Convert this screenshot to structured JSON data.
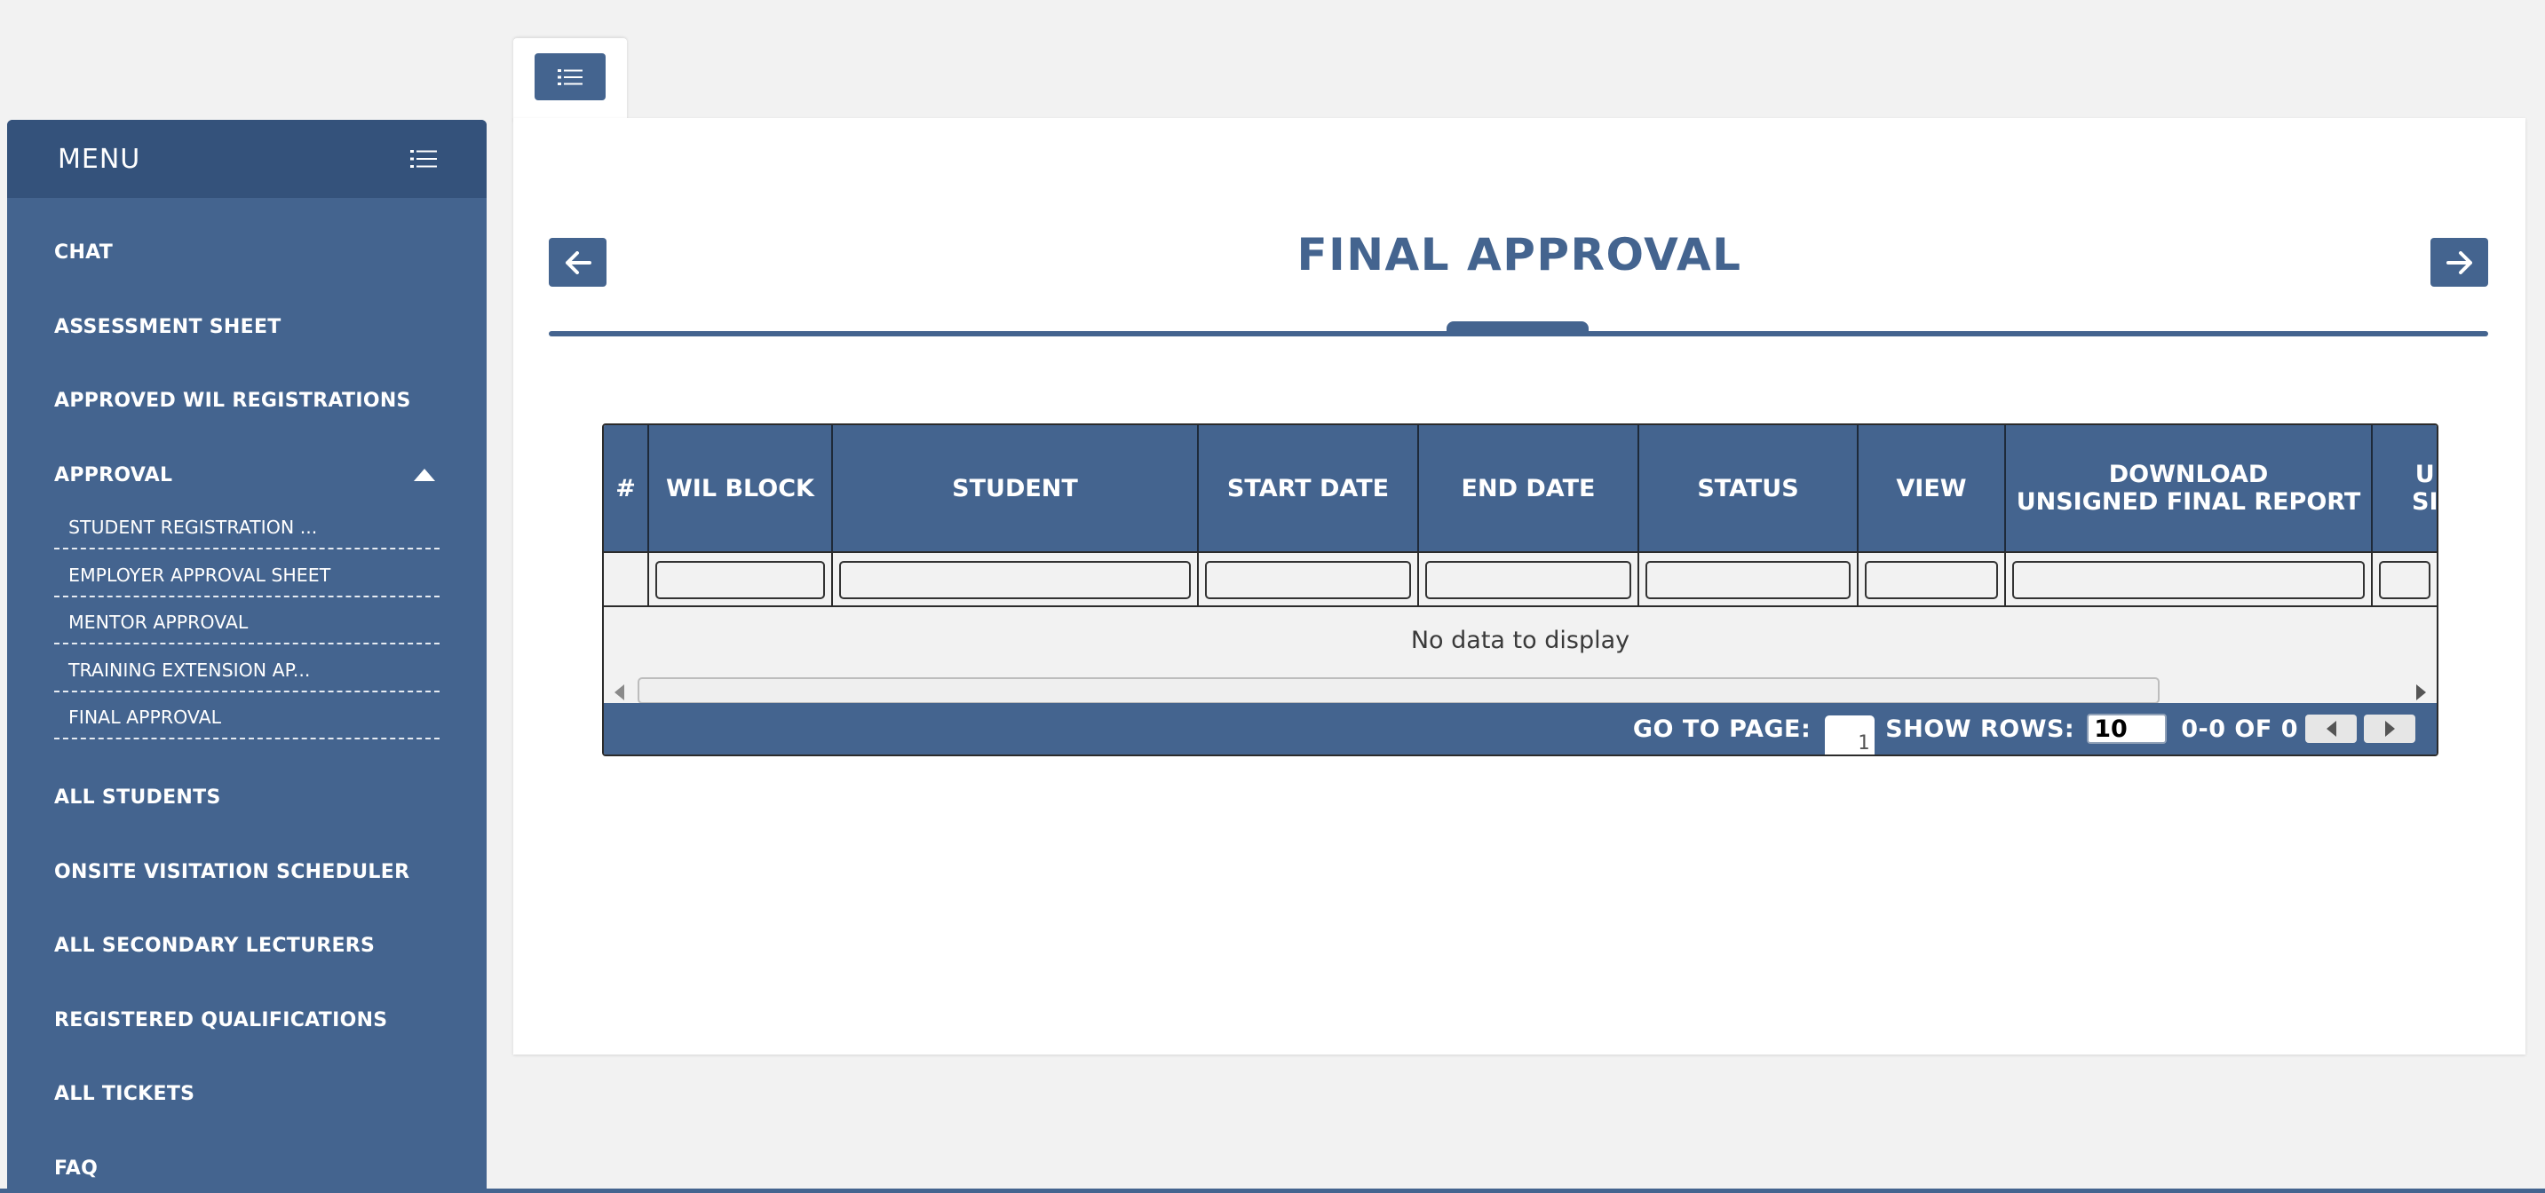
{
  "sidebar": {
    "title": "MENU",
    "items": [
      {
        "label": "CHAT"
      },
      {
        "label": "ASSESSMENT SHEET"
      },
      {
        "label": "APPROVED WIL REGISTRATIONS"
      },
      {
        "label": "APPROVAL"
      },
      {
        "label": "ALL STUDENTS"
      },
      {
        "label": "ONSITE VISITATION SCHEDULER"
      },
      {
        "label": "ALL SECONDARY LECTURERS"
      },
      {
        "label": "REGISTERED QUALIFICATIONS"
      },
      {
        "label": "ALL TICKETS"
      },
      {
        "label": "FAQ"
      }
    ],
    "approval_subitems": [
      {
        "label": "STUDENT REGISTRATION ..."
      },
      {
        "label": "EMPLOYER APPROVAL SHEET"
      },
      {
        "label": "MENTOR APPROVAL"
      },
      {
        "label": "TRAINING EXTENSION AP..."
      },
      {
        "label": "FINAL APPROVAL"
      }
    ]
  },
  "main": {
    "title": "FINAL APPROVAL",
    "grid": {
      "columns": [
        {
          "label": "#"
        },
        {
          "label": "WIL BLOCK"
        },
        {
          "label": "STUDENT"
        },
        {
          "label": "START DATE"
        },
        {
          "label": "END DATE"
        },
        {
          "label": "STATUS"
        },
        {
          "label": "VIEW"
        },
        {
          "label": "DOWNLOAD\nUNSIGNED FINAL REPORT"
        },
        {
          "label": "U\nSI"
        }
      ],
      "empty_text": "No data to display",
      "pager": {
        "goto_label": "GO TO PAGE:",
        "page_value": "1",
        "rows_label": "SHOW ROWS:",
        "rows_value": "10",
        "range_text": "0-0 OF 0"
      }
    }
  },
  "colors": {
    "primary": "#44648f",
    "header_dark": "#34527b",
    "background": "#f2f2f2"
  },
  "icons": [
    "list-icon",
    "menu-list-icon",
    "caret-up-icon",
    "arrow-left-icon",
    "arrow-right-icon",
    "scroll-left-icon",
    "scroll-right-icon",
    "page-prev-icon",
    "page-next-icon"
  ]
}
